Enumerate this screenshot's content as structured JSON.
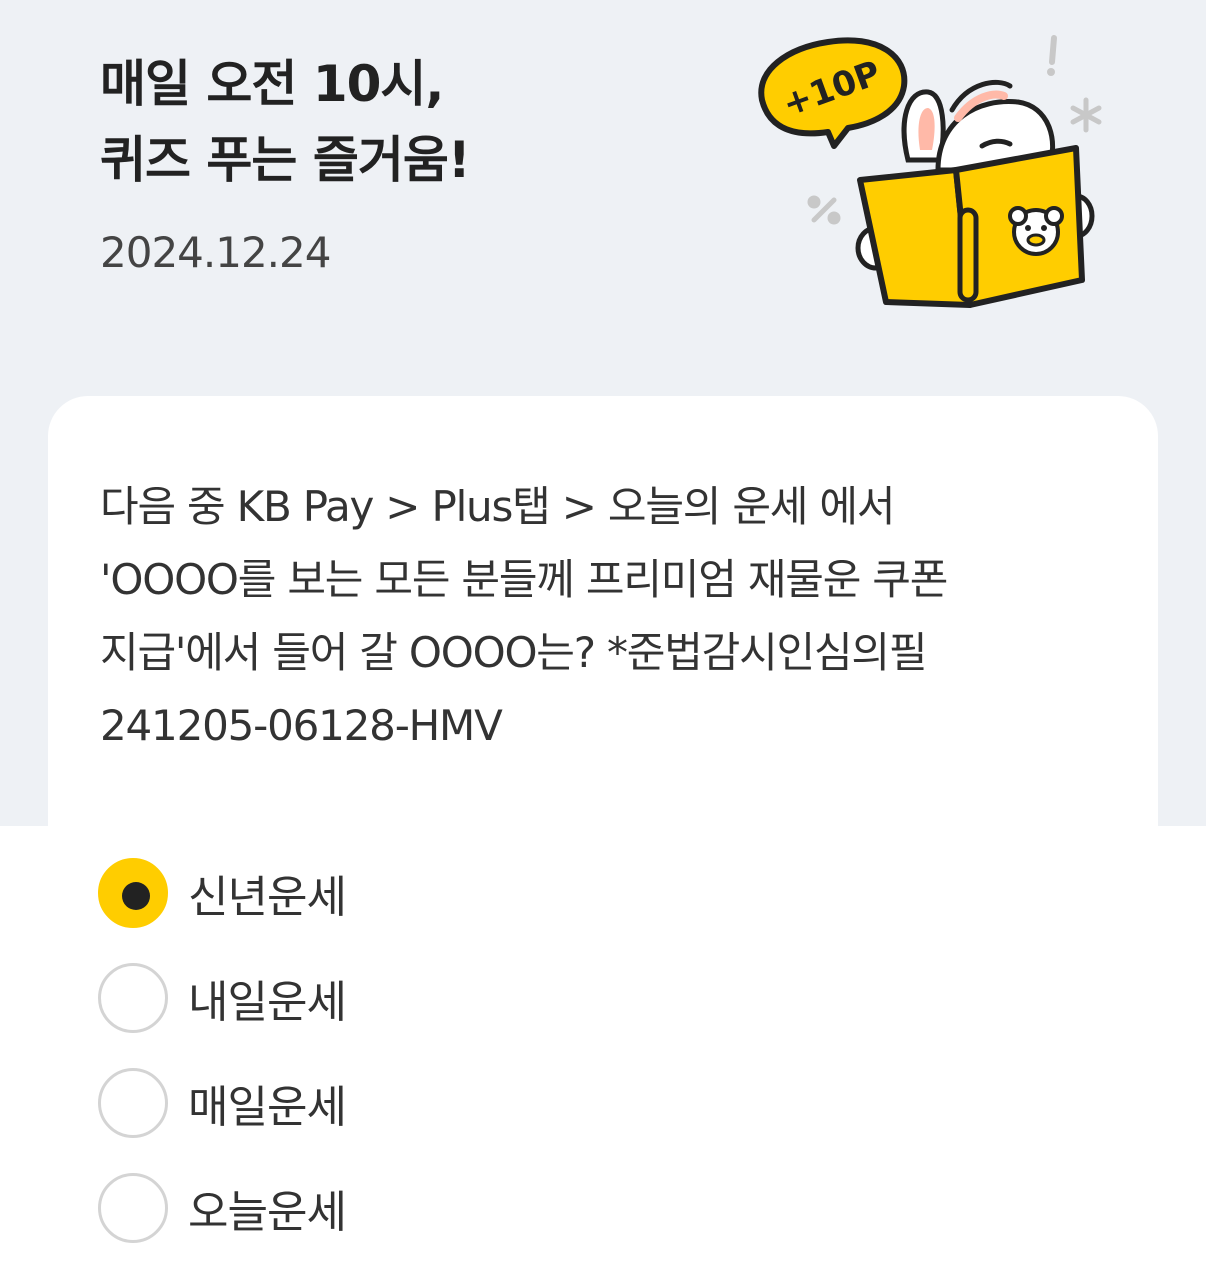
{
  "header": {
    "title_lines": [
      "매일 오전 10시,",
      "퀴즈 푸는 즐거움!"
    ],
    "date": "2024.12.24"
  },
  "illustration": {
    "badge_text": "+10P",
    "accent_color": "#ffcd00"
  },
  "quiz": {
    "question_lines": [
      "다음 중 KB Pay > Plus탭 > 오늘의 운세 에서",
      "'OOOO를 보는 모든 분들께 프리미엄 재물운 쿠폰",
      "지급'에서 들어 갈 OOOO는? *준법감시인심의필",
      "241205-06128-HMV"
    ],
    "options": [
      {
        "label": "신년운세",
        "selected": true
      },
      {
        "label": "내일운세",
        "selected": false
      },
      {
        "label": "매일운세",
        "selected": false
      },
      {
        "label": "오늘운세",
        "selected": false
      }
    ]
  }
}
